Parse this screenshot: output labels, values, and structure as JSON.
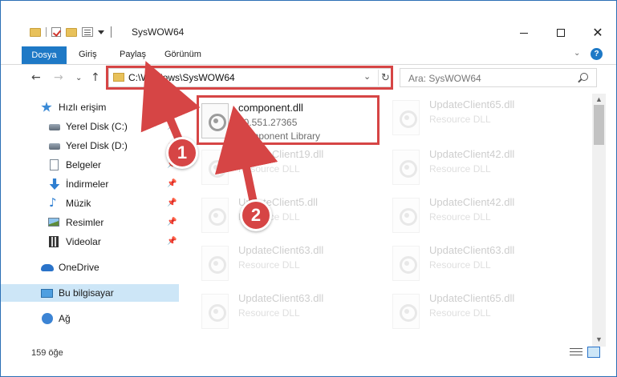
{
  "window": {
    "title": "SysWOW64"
  },
  "ribbon": {
    "tabs": [
      "Dosya",
      "Giriş",
      "Paylaş",
      "Görünüm"
    ]
  },
  "address": {
    "path": "C:\\Windows\\SysWOW64"
  },
  "search": {
    "placeholder": "Ara: SysWOW64"
  },
  "sidebar": {
    "items": [
      {
        "label": "Hızlı erişim",
        "icon": "star-icon",
        "pinned": false
      },
      {
        "label": "Yerel Disk (C:)",
        "icon": "drive-icon",
        "pinned": true
      },
      {
        "label": "Yerel Disk (D:)",
        "icon": "drive-icon",
        "pinned": true
      },
      {
        "label": "Belgeler",
        "icon": "documents-icon",
        "pinned": true
      },
      {
        "label": "İndirmeler",
        "icon": "downloads-icon",
        "pinned": true
      },
      {
        "label": "Müzik",
        "icon": "music-icon",
        "pinned": true
      },
      {
        "label": "Resimler",
        "icon": "pictures-icon",
        "pinned": true
      },
      {
        "label": "Videolar",
        "icon": "videos-icon",
        "pinned": true
      },
      {
        "label": "OneDrive",
        "icon": "cloud-icon",
        "pinned": false
      },
      {
        "label": "Bu bilgisayar",
        "icon": "computer-icon",
        "pinned": false,
        "selected": true
      },
      {
        "label": "Ağ",
        "icon": "network-icon",
        "pinned": false
      }
    ]
  },
  "files": {
    "highlighted": {
      "name": "component.dll",
      "version": "10.551.27365",
      "description": "Component Library"
    },
    "faded": [
      {
        "name": "UpdateClient65.dll",
        "description": "Resource DLL"
      },
      {
        "name": "UpdateClient19.dll",
        "description": "Resource DLL"
      },
      {
        "name": "UpdateClient42.dll",
        "description": "Resource DLL"
      },
      {
        "name": "UpdateClient5.dll",
        "description": "Resource DLL"
      },
      {
        "name": "UpdateClient42.dll",
        "description": "Resource DLL"
      },
      {
        "name": "UpdateClient63.dll",
        "description": "Resource DLL"
      },
      {
        "name": "UpdateClient63.dll",
        "description": "Resource DLL"
      },
      {
        "name": "UpdateClient63.dll",
        "description": "Resource DLL"
      },
      {
        "name": "UpdateClient65.dll",
        "description": "Resource DLL"
      }
    ]
  },
  "status": {
    "count": "159 öğe"
  },
  "callouts": [
    "1",
    "2"
  ],
  "colors": {
    "accent": "#1e79c6",
    "highlight_frame": "#d64545",
    "selection": "#cde6f7"
  }
}
